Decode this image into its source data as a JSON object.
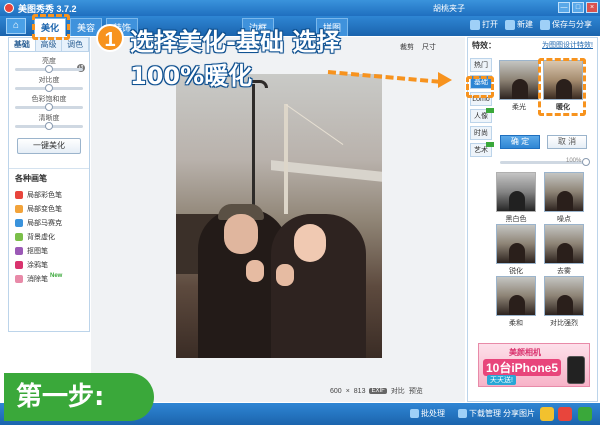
{
  "titlebar": {
    "title": "美图秀秀 3.7.2",
    "user": "胡桃夹子",
    "buttons": [
      "—",
      "□",
      "×"
    ]
  },
  "nav": {
    "tabs": [
      "美化",
      "美容",
      "装饰",
      "边框",
      "拼图"
    ],
    "actions": {
      "open": "打开",
      "new": "新建",
      "save": "保存与分享"
    }
  },
  "left": {
    "subtabs": [
      "基础",
      "高级",
      "调色"
    ],
    "sliders": [
      {
        "label": "亮度",
        "value": 0.5
      },
      {
        "label": "对比度",
        "value": 0.5
      },
      {
        "label": "色彩饱和度",
        "value": 0.5
      },
      {
        "label": "清晰度",
        "value": 0.5
      }
    ],
    "one_click": "一键美化",
    "tools_title": "各种画笔",
    "tools": [
      {
        "label": "局部彩色笔",
        "color": "#e8453c"
      },
      {
        "label": "局部变色笔",
        "color": "#f2a33a"
      },
      {
        "label": "局部马赛克",
        "color": "#3a93dc"
      },
      {
        "label": "背景虚化",
        "color": "#7bbf4a"
      },
      {
        "label": "抠图笔",
        "color": "#9b59b6"
      },
      {
        "label": "涂鸦笔",
        "color": "#d9336e"
      },
      {
        "label": "消除笔",
        "color": "#e88aa8",
        "badge": "New"
      }
    ]
  },
  "toolrow": {
    "crop": "裁剪",
    "size": "尺寸"
  },
  "canvas": {
    "size_w": "600",
    "size_x": "×",
    "size_h": "813",
    "exif": "EXIF",
    "compare": "对比",
    "preview": "预览"
  },
  "right": {
    "title": "特效：",
    "link": "为图图设计特效!",
    "categories": [
      "热门",
      "基础",
      "Lomo",
      "人像",
      "时尚",
      "艺术"
    ],
    "top_thumbs": [
      "柔光",
      "暖化"
    ],
    "strength": "100%",
    "strength_value": 1.0,
    "ok": "确 定",
    "cancel": "取 消",
    "effects": [
      "黑白色",
      "噪点",
      "锐化",
      "去雾",
      "柔和",
      "对比强烈"
    ],
    "ad": {
      "brand": "美颜相机",
      "offer": "10台iPhone5",
      "daily": "天天送!"
    }
  },
  "bottom": {
    "batch": "批处理",
    "download": "下载管理",
    "share": "分享图片"
  },
  "annotation": {
    "number": "1",
    "line1": "选择美化-基础  选择",
    "line2": "100%暖化",
    "step": "第一步:",
    "accent": "#f7931e",
    "step_color": "#3aa83a"
  }
}
